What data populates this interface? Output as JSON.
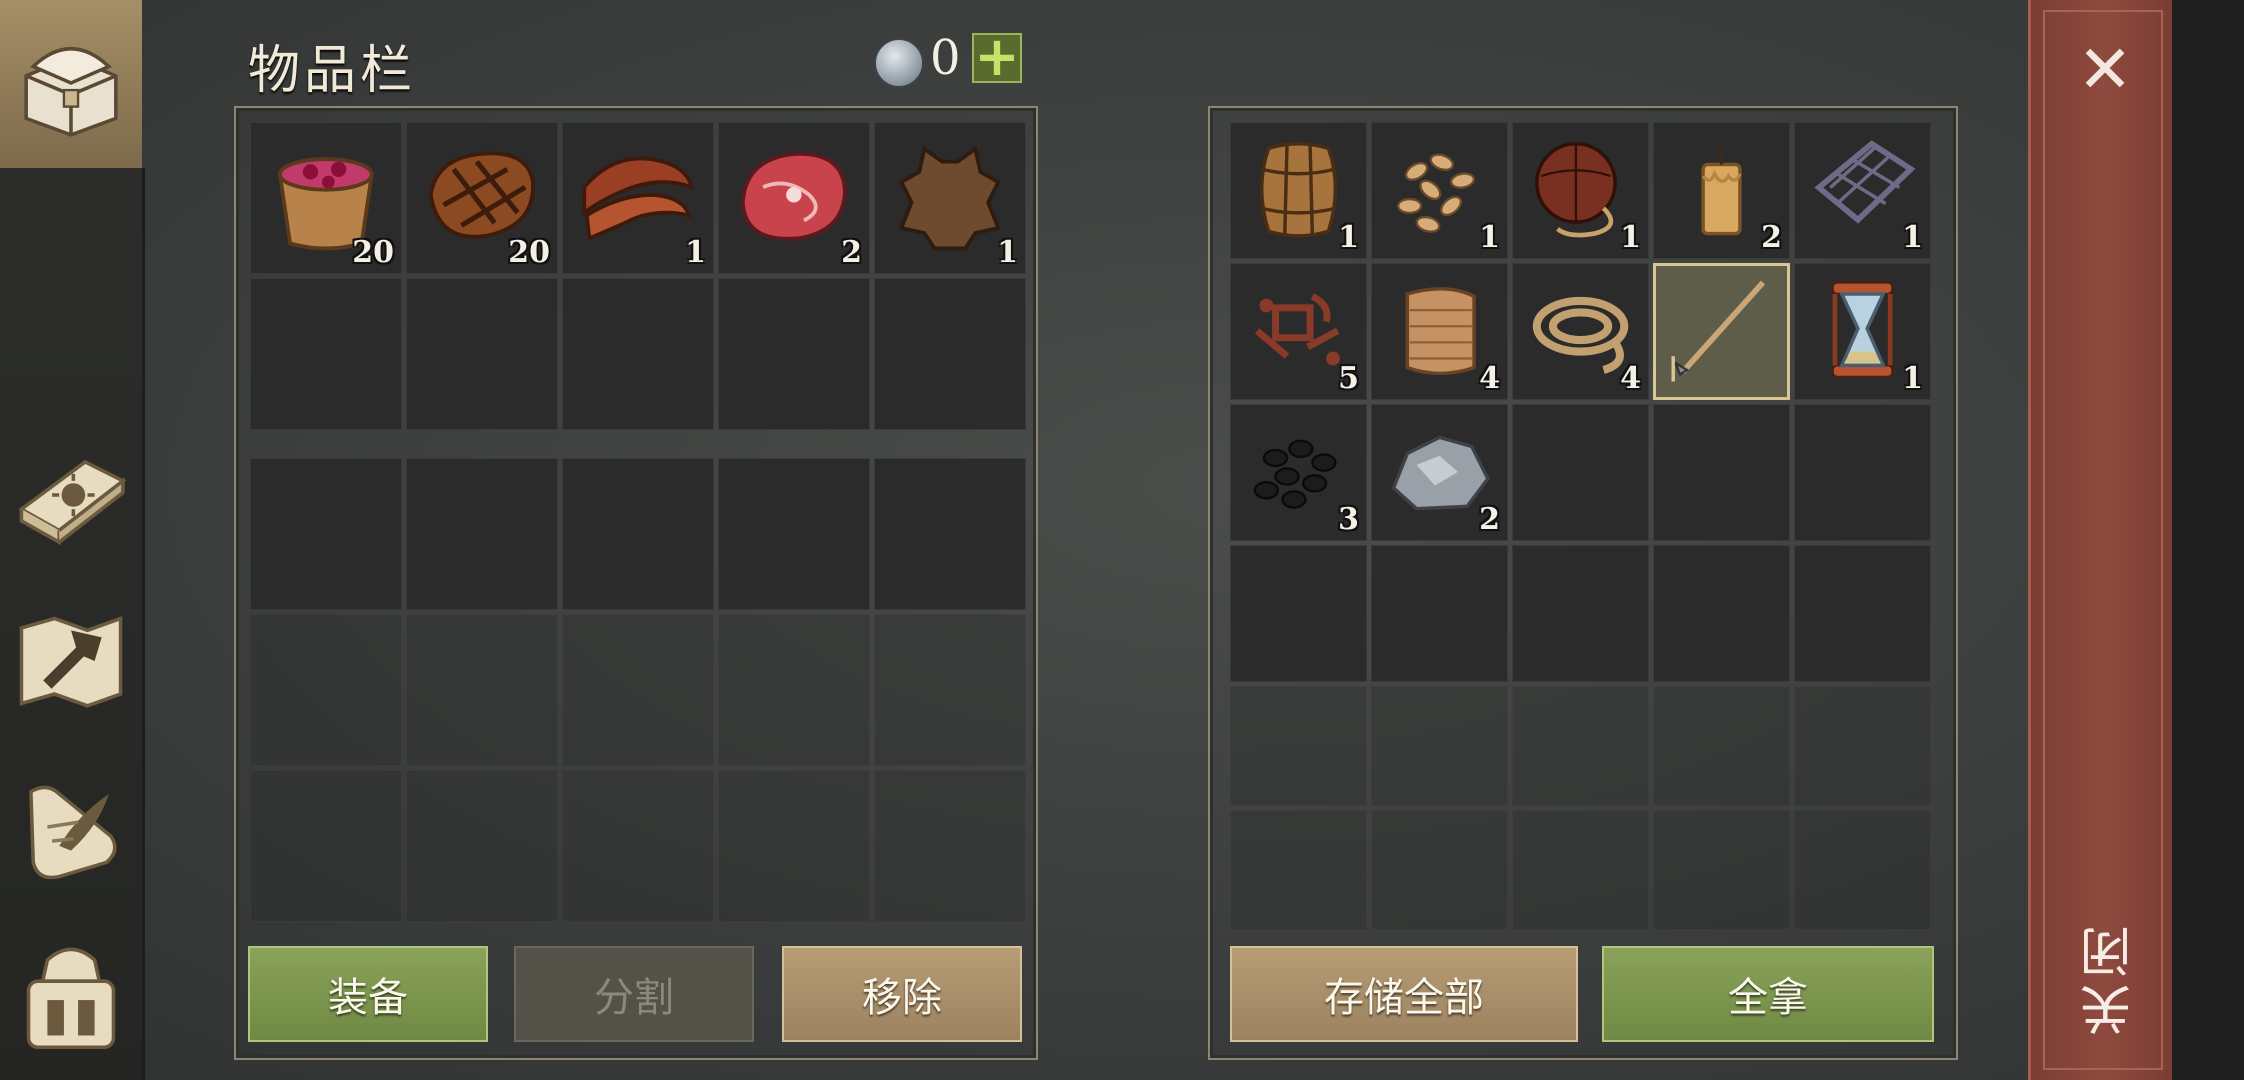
{
  "header": {
    "title": "物品栏",
    "currency_count": "0",
    "add_currency_label": "+"
  },
  "inventory": {
    "rows": [
      [
        {
          "item": "berry-bowl",
          "qty": "20"
        },
        {
          "item": "grilled-steak",
          "qty": "20"
        },
        {
          "item": "bacon-strips",
          "qty": "1"
        },
        {
          "item": "raw-meat",
          "qty": "2"
        },
        {
          "item": "animal-hide",
          "qty": "1"
        }
      ],
      [
        {},
        {},
        {},
        {},
        {}
      ]
    ],
    "extra_rows": [
      [
        {},
        {},
        {},
        {},
        {}
      ],
      [
        {},
        {},
        {},
        {},
        {}
      ],
      [
        {},
        {},
        {},
        {},
        {}
      ]
    ]
  },
  "storage": {
    "rows": [
      [
        {
          "item": "wooden-barrel",
          "qty": "1"
        },
        {
          "item": "seeds",
          "qty": "1"
        },
        {
          "item": "leather-flask",
          "qty": "1"
        },
        {
          "item": "candle",
          "qty": "2"
        },
        {
          "item": "lattice-frame",
          "qty": "1"
        }
      ],
      [
        {
          "item": "broken-parts",
          "qty": "5"
        },
        {
          "item": "cloth-roll",
          "qty": "4"
        },
        {
          "item": "rope-coil",
          "qty": "4"
        },
        {
          "item": "spear",
          "qty": "",
          "selected": true
        },
        {
          "item": "hourglass",
          "qty": "1"
        }
      ],
      [
        {
          "item": "coal",
          "qty": "3"
        },
        {
          "item": "stone-ore",
          "qty": "2"
        },
        {},
        {},
        {}
      ],
      [
        {},
        {},
        {},
        {},
        {}
      ],
      [
        {},
        {},
        {},
        {},
        {}
      ],
      [
        {},
        {},
        {},
        {},
        {}
      ]
    ]
  },
  "buttons": {
    "equip": "装备",
    "split": "分割",
    "remove": "移除",
    "store_all": "存储全部",
    "take_all": "全拿"
  },
  "close": {
    "label": "关闭",
    "x_glyph": "✕"
  },
  "sidebar": {
    "items": [
      {
        "icon": "chest-icon",
        "active": true
      },
      {
        "icon": "sun-book-icon"
      },
      {
        "icon": "map-hammer-icon"
      },
      {
        "icon": "scroll-quill-icon"
      },
      {
        "icon": "backpack-icon"
      }
    ]
  },
  "colors": {
    "accent_green": "#8aa25a",
    "button_tan": "#b79c74",
    "close_strip": "#8e4a3e",
    "selected_border": "#d8c792"
  }
}
